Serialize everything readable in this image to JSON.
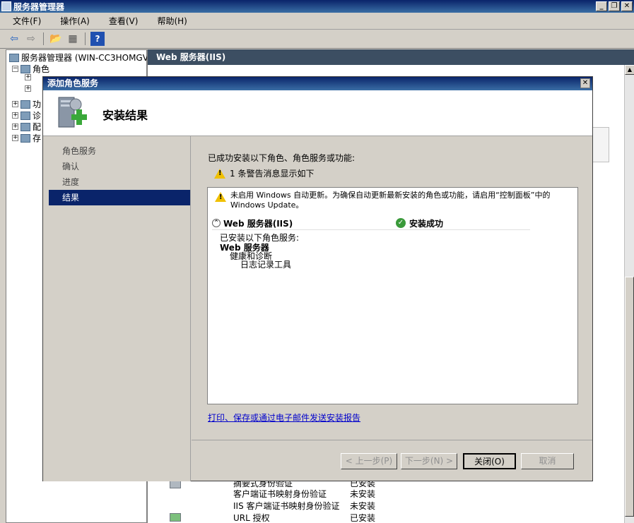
{
  "window": {
    "title": "服务器管理器",
    "menu": [
      "文件(F)",
      "操作(A)",
      "查看(V)",
      "帮助(H)"
    ]
  },
  "tree": {
    "root": "服务器管理器 (WIN-CC3HOMGVK9",
    "roles": "角色",
    "partial_items": [
      "功",
      "诊",
      "配",
      "存"
    ]
  },
  "right_pane": {
    "header": "Web 服务器(IIS)",
    "rows": [
      {
        "name": "摘要式身份验证",
        "status": "已安装"
      },
      {
        "name": "客户端证书映射身份验证",
        "status": "未安装"
      },
      {
        "name": "IIS 客户端证书映射身份验证",
        "status": "未安装"
      },
      {
        "name": "URL 授权",
        "status": "已安装"
      }
    ]
  },
  "dialog": {
    "title": "添加角色服务",
    "heading": "安装结果",
    "steps": [
      "角色服务",
      "确认",
      "进度",
      "结果"
    ],
    "active_step": 3,
    "intro": "已成功安装以下角色、角色服务或功能:",
    "warning_summary": "1 条警告消息显示如下",
    "warning_text": "未启用 Windows 自动更新。为确保自动更新最新安装的角色或功能，请启用“控制面板”中的 Windows Update。",
    "section_title": "Web 服务器(IIS)",
    "section_status": "安装成功",
    "installed_label": "已安装以下角色服务:",
    "installed_tree": [
      "Web 服务器",
      "健康和诊断",
      "日志记录工具"
    ],
    "report_link": "打印、保存或通过电子邮件发送安装报告",
    "buttons": {
      "prev": "< 上一步(P)",
      "next": "下一步(N) >",
      "close": "关闭(O)",
      "cancel": "取消"
    }
  }
}
